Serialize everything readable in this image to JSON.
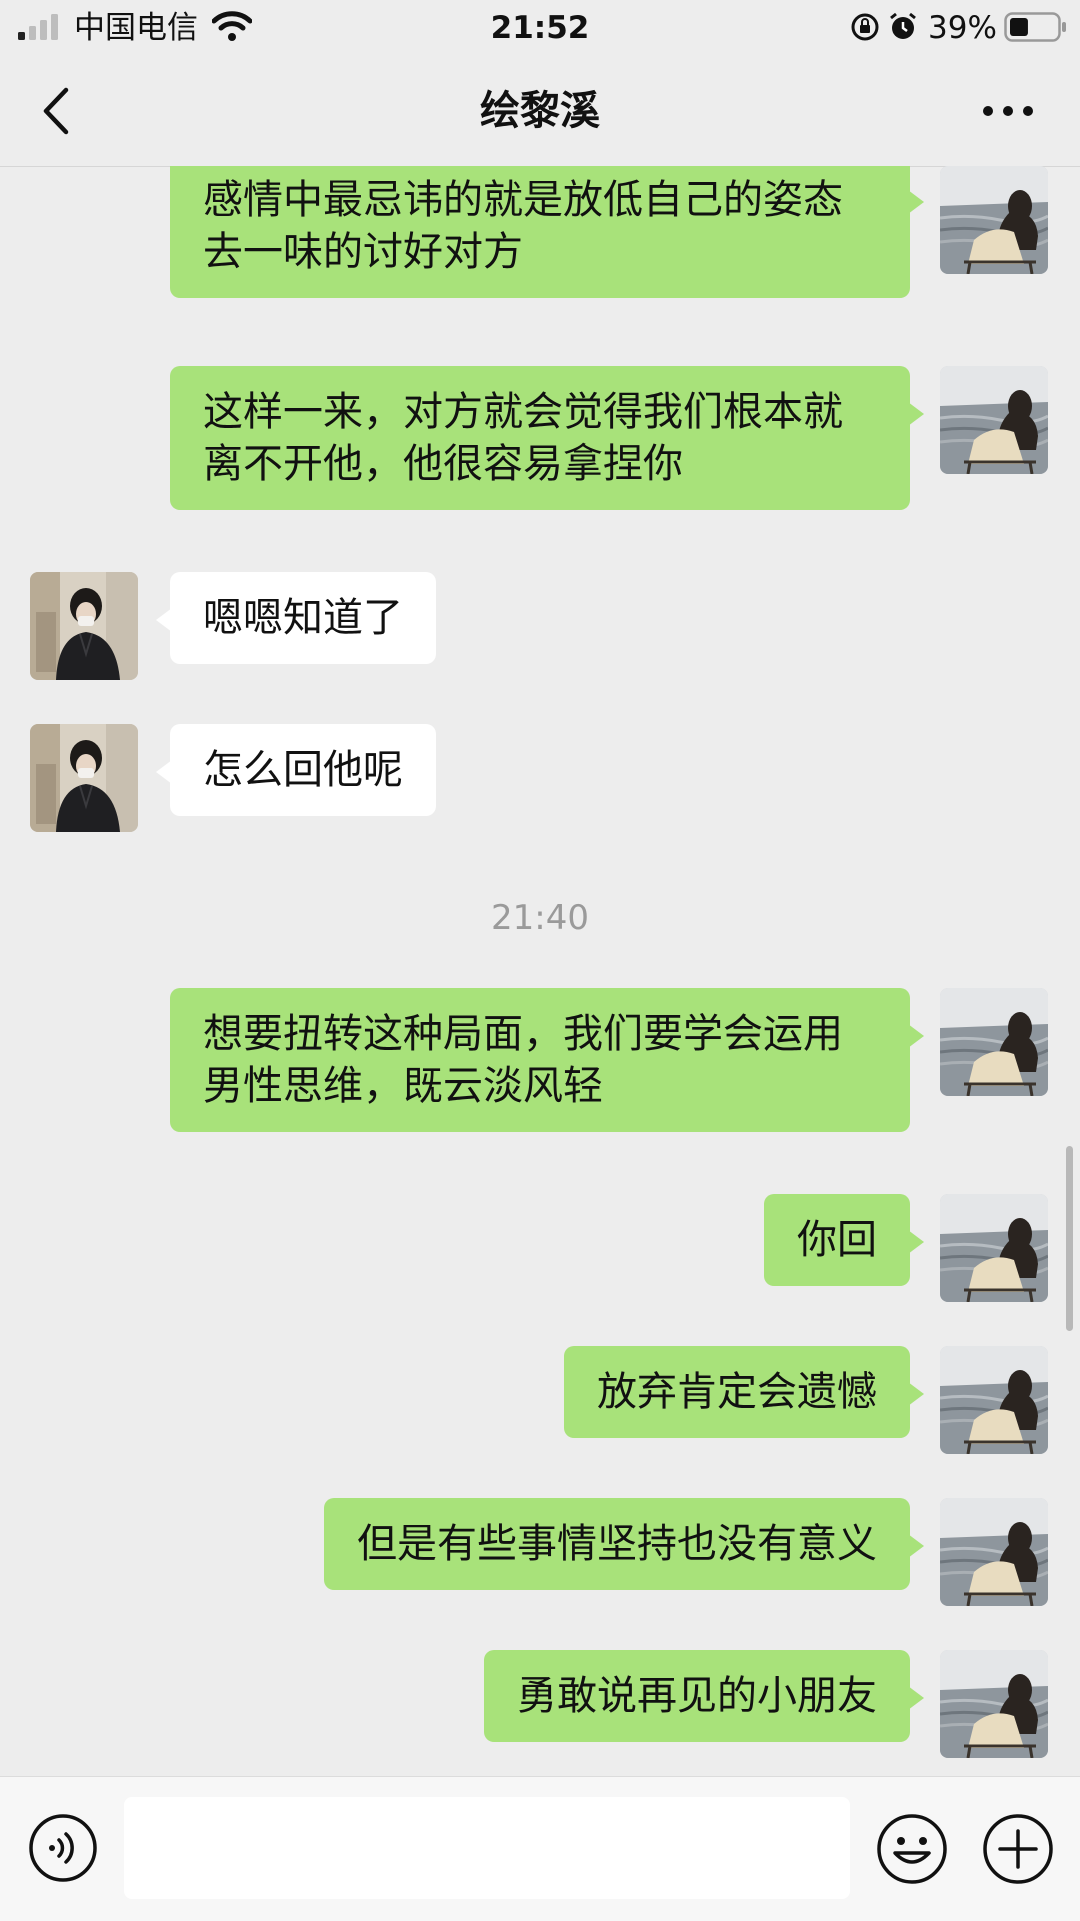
{
  "status_bar": {
    "carrier": "中国电信",
    "time": "21:52",
    "battery_percent": "39%",
    "battery_level": 0.39
  },
  "header": {
    "title": "绘黎溪"
  },
  "messages": [
    {
      "sender": "me",
      "text": "感情中最忌讳的就是放低自己的姿态去一味的讨好对方"
    },
    {
      "sender": "me",
      "text": "这样一来，对方就会觉得我们根本就离不开他，他很容易拿捏你"
    },
    {
      "sender": "them",
      "text": "嗯嗯知道了"
    },
    {
      "sender": "them",
      "text": "怎么回他呢"
    },
    {
      "sender": "me",
      "text": "想要扭转这种局面，我们要学会运用男性思维，既云淡风轻"
    },
    {
      "sender": "me",
      "text": "你回"
    },
    {
      "sender": "me",
      "text": "放弃肯定会遗憾"
    },
    {
      "sender": "me",
      "text": "但是有些事情坚持也没有意义"
    },
    {
      "sender": "me",
      "text": "勇敢说再见的小朋友"
    }
  ],
  "timestamp": "21:40",
  "icons": {
    "back": "back-chevron-icon",
    "more": "more-dots-icon",
    "voice": "voice-icon",
    "emoji": "emoji-icon",
    "plus": "plus-icon",
    "signal": "signal-icon",
    "wifi": "wifi-icon",
    "rotation_lock": "rotation-lock-icon",
    "alarm": "alarm-icon",
    "battery": "battery-icon"
  },
  "colors": {
    "my_bubble": "#a8e27a",
    "their_bubble": "#ffffff",
    "background": "#ededed"
  }
}
